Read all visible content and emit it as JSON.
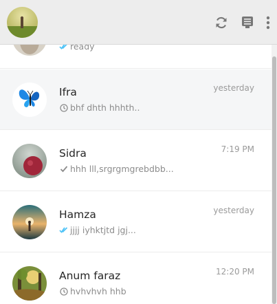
{
  "header": {
    "icons": [
      "refresh-icon",
      "new-chat-icon",
      "more-vert-icon"
    ]
  },
  "chats": [
    {
      "name": "",
      "time": "",
      "preview": "ready",
      "status": "read",
      "avatar": "partial-person"
    },
    {
      "name": "Ifra",
      "time": "yesterday",
      "preview": "bhf dhth hhhth..",
      "status": "pending",
      "avatar": "butterfly"
    },
    {
      "name": "Sidra",
      "time": "7:19 PM",
      "preview": "hhh lll,srgrgmgrebdbb...",
      "status": "sent",
      "avatar": "apple"
    },
    {
      "name": "Hamza",
      "time": "yesterday",
      "preview": "jjjj iyhktjtd jgj...",
      "status": "read",
      "avatar": "sunset-person"
    },
    {
      "name": "Anum faraz",
      "time": "12:20 PM",
      "preview": "hvhvhvh hhb",
      "status": "pending",
      "avatar": "forest"
    }
  ],
  "colors": {
    "read_tick": "#4fc3f7",
    "muted_text": "#8c8c8c",
    "header_bg": "#ededed",
    "active_row": "#f5f6f7"
  }
}
